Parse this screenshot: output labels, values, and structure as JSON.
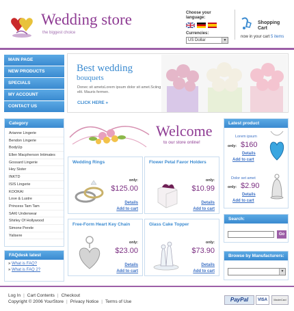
{
  "header": {
    "logo_title": "Wedding store",
    "logo_subtitle": "the biggest choice",
    "language_label": "Choose your language:",
    "currencies_label": "Currencies:",
    "currency_value": "US Dollar",
    "cart_label": "Shopping Cart",
    "cart_now_prefix": "now in your cart",
    "cart_items": "5 items"
  },
  "nav": [
    "MAIN PAGE",
    "NEW PRODUCTS",
    "SPECIALS",
    "MY ACCOUNT",
    "CONTACT US"
  ],
  "banner": {
    "title": "Best wedding",
    "subtitle": "bouquets",
    "text": "Donec sit ametsLorem ipsum dolor sit amet.Sciing elit. Mauris fermen.",
    "more": "CLICK HERE »"
  },
  "category": {
    "title": "Category",
    "items": [
      "Arianne Lingerie",
      "Bendon Lingerie",
      "BodyUp",
      "Ellen Macpherson Intimates",
      "Gossard Lingerie",
      "Hey Sister",
      "INKTD",
      "ISIS Lingerie",
      "KOOKAI",
      "Love & Lustre",
      "Princess Tam Tam",
      "SAKI Underwear",
      "Shirley Of Hollywood",
      "Simone Perele",
      "Yalisere"
    ]
  },
  "faq": {
    "title": "FAQdesk latest",
    "items": [
      "What is FAQ?",
      "What is FAQ 2?"
    ]
  },
  "welcome": {
    "title": "Welcome",
    "subtitle": "to our store online!"
  },
  "products": [
    {
      "name": "Wedding Rings",
      "only": "only:",
      "price": "$125.00",
      "details": "Details",
      "add": "Add to cart"
    },
    {
      "name": "Flower Petal Favor Holders",
      "only": "only:",
      "price": "$10.99",
      "details": "Details",
      "add": "Add to cart"
    },
    {
      "name": "Free-Form Heart Key Chain",
      "only": "only:",
      "price": "$23.00",
      "details": "Details",
      "add": "Add to cart"
    },
    {
      "name": "Glass Cake Topper",
      "only": "only:",
      "price": "$73.90",
      "details": "Details",
      "add": "Add to cart"
    }
  ],
  "latest": {
    "title": "Latest product",
    "items": [
      {
        "name": "Lorem ipsum",
        "only": "only:",
        "price": "$160",
        "details": "Details",
        "add": "Add to cart"
      },
      {
        "name": "Dolor set amet",
        "only": "only:",
        "price": "$2.90",
        "details": "Details",
        "add": "Add to cart"
      }
    ]
  },
  "search": {
    "title": "Search:",
    "button": "Go"
  },
  "manufacturers": {
    "title": "Browse by Manufacturers:"
  },
  "footer": {
    "links": [
      "Log In",
      "Cart Contents",
      "Checkout"
    ],
    "copyright": "Copyright © 2006 YourStore",
    "links2": [
      "Privacy Notice",
      "Terms of Use"
    ],
    "payment": [
      "PayPal",
      "VISA",
      "MasterCard"
    ]
  },
  "colors": {
    "accent_purple": "#8e3b93",
    "accent_blue": "#3a8ad0"
  }
}
